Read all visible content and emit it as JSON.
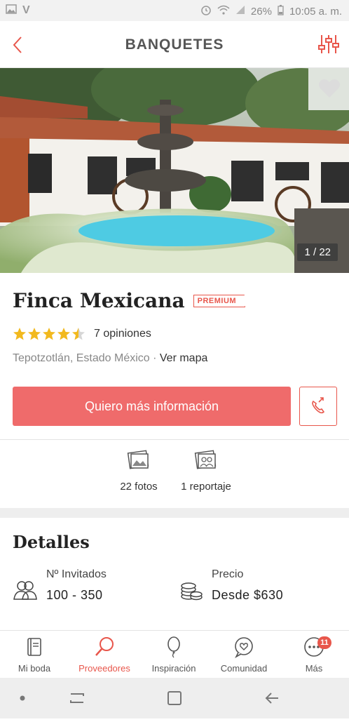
{
  "status": {
    "battery": "26%",
    "time": "10:05 a. m."
  },
  "header": {
    "title": "BANQUETES"
  },
  "gallery": {
    "counter": "1 / 22"
  },
  "venue": {
    "name": "Finca Mexicana",
    "badge": "PREMIUM",
    "rating_value": 4.5,
    "reviews": "7 opiniones",
    "location": "Tepotzotlán, Estado México",
    "separator": " · ",
    "map_link": "Ver mapa"
  },
  "actions": {
    "cta": "Quiero más información"
  },
  "media": {
    "photos": "22 fotos",
    "reports": "1 reportaje"
  },
  "details": {
    "title": "Detalles",
    "guests_label": "Nº Invitados",
    "guests_value": "100 - 350",
    "price_label": "Precio",
    "price_value": "Desde $630"
  },
  "tabs": [
    {
      "label": "Mi boda",
      "icon": "notebook-icon"
    },
    {
      "label": "Proveedores",
      "icon": "search-icon"
    },
    {
      "label": "Inspiración",
      "icon": "balloon-icon"
    },
    {
      "label": "Comunidad",
      "icon": "chat-heart-icon"
    },
    {
      "label": "Más",
      "icon": "more-icon",
      "badge": "11"
    }
  ],
  "colors": {
    "accent": "#e8564b",
    "cta_bg": "#ef6b6b",
    "star": "#f2b91e"
  }
}
